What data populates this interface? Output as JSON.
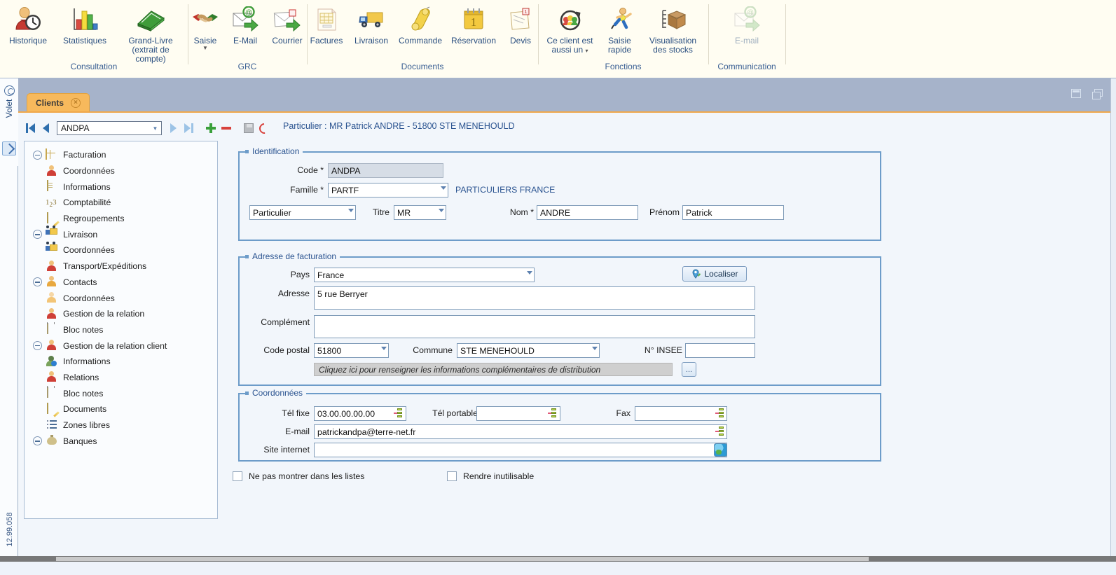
{
  "ribbon": {
    "groups": [
      {
        "title": "Consultation",
        "items": [
          {
            "label": "Historique",
            "icon": "history-person-clock-icon",
            "wide": false,
            "caret": false
          },
          {
            "label": "Statistiques",
            "icon": "bar-chart-icon",
            "wide": false,
            "caret": false
          },
          {
            "label": "Grand-Livre\n(extrait de compte)",
            "icon": "green-book-icon",
            "wide": true,
            "caret": false
          }
        ]
      },
      {
        "title": "GRC",
        "items": [
          {
            "label": "Saisie",
            "icon": "handshake-icon",
            "wide": false,
            "caret": true
          },
          {
            "label": "E-Mail",
            "icon": "email-arrow-icon",
            "wide": false,
            "caret": false
          },
          {
            "label": "Courrier",
            "icon": "letter-arrow-icon",
            "wide": false,
            "caret": false
          }
        ]
      },
      {
        "title": "Documents",
        "items": [
          {
            "label": "Factures",
            "icon": "invoice-icon",
            "wide": false,
            "caret": false
          },
          {
            "label": "Livraison",
            "icon": "truck-icon",
            "wide": false,
            "caret": false
          },
          {
            "label": "Commande",
            "icon": "phone-handset-icon",
            "wide": false,
            "caret": false
          },
          {
            "label": "Réservation",
            "icon": "calendar-icon",
            "wide": false,
            "caret": false
          },
          {
            "label": "Devis",
            "icon": "envelope-stack-icon",
            "wide": false,
            "caret": false
          }
        ]
      },
      {
        "title": "Fonctions",
        "items": [
          {
            "label": "Ce client est\naussi un",
            "icon": "group-refresh-icon",
            "wide": true,
            "caret": true
          },
          {
            "label": "Saisie\nrapide",
            "icon": "running-man-icon",
            "wide": true,
            "caret": false
          },
          {
            "label": "Visualisation\ndes stocks",
            "icon": "box-stock-icon",
            "wide": true,
            "caret": false
          }
        ]
      },
      {
        "title": "Communication",
        "items": [
          {
            "label": "E-mail",
            "icon": "email-arrow-disabled-icon",
            "wide": false,
            "caret": false
          }
        ]
      }
    ]
  },
  "leftrail": {
    "panel_label": "Volet",
    "version": "12.99.058"
  },
  "tabbar": {
    "tabs": [
      {
        "label": "Clients",
        "close": "×"
      }
    ]
  },
  "navbar": {
    "first_label": "first-record",
    "prev_label": "previous-record",
    "next_label": "next-record",
    "last_label": "last-record",
    "code_value": "ANDPA",
    "add_label": "add-record",
    "delete_label": "delete-record",
    "save_label": "save-record",
    "undo_label": "undo-changes",
    "record_title": "Particulier : MR Patrick ANDRE - 51800 STE MENEHOULD"
  },
  "tree": {
    "nodes": [
      {
        "label": "Facturation",
        "level": 0,
        "expander": true,
        "icon": "grid-icon"
      },
      {
        "label": "Coordonnées",
        "level": 1,
        "expander": false,
        "icon": "person-red-icon"
      },
      {
        "label": "Informations",
        "level": 1,
        "expander": false,
        "icon": "document-icon"
      },
      {
        "label": "Comptabilité",
        "level": 1,
        "expander": false,
        "icon": "numbers-123-icon"
      },
      {
        "label": "Regroupements",
        "level": 1,
        "expander": false,
        "icon": "regroup-doc-icon"
      },
      {
        "label": "Livraison",
        "level": 0,
        "expander": true,
        "icon": "truck-icon"
      },
      {
        "label": "Coordonnées",
        "level": 1,
        "expander": false,
        "icon": "truck-icon"
      },
      {
        "label": "Transport/Expéditions",
        "level": 1,
        "expander": false,
        "icon": "transport-icon"
      },
      {
        "label": "Contacts",
        "level": 0,
        "expander": true,
        "icon": "person-icon"
      },
      {
        "label": "Coordonnées",
        "level": 1,
        "expander": false,
        "icon": "person-pale-icon"
      },
      {
        "label": "Gestion de la relation",
        "level": 1,
        "expander": false,
        "icon": "relation-icon"
      },
      {
        "label": "Bloc notes",
        "level": 1,
        "expander": false,
        "icon": "notepad-icon"
      },
      {
        "label": "Gestion de la relation client",
        "level": 0,
        "expander": true,
        "icon": "relation-client-icon"
      },
      {
        "label": "Informations",
        "level": 1,
        "expander": false,
        "icon": "info-person-icon"
      },
      {
        "label": "Relations",
        "level": 1,
        "expander": false,
        "icon": "relation-icon"
      },
      {
        "label": "Bloc notes",
        "level": 0,
        "expander": false,
        "icon": "notepad-icon"
      },
      {
        "label": "Documents",
        "level": 0,
        "expander": false,
        "icon": "documents-pencil-icon"
      },
      {
        "label": "Zones libres",
        "level": 0,
        "expander": false,
        "icon": "list-icon"
      },
      {
        "label": "Banques",
        "level": 0,
        "expander": true,
        "icon": "money-bag-icon"
      }
    ]
  },
  "form": {
    "identification": {
      "legend": "Identification",
      "code_label": "Code *",
      "code_value": "ANDPA",
      "famille_label": "Famille *",
      "famille_value": "PARTF",
      "famille_desc": "PARTICULIERS FRANCE",
      "type_value": "Particulier",
      "titre_label": "Titre",
      "titre_value": "MR",
      "nom_label": "Nom *",
      "nom_value": "ANDRE",
      "prenom_label": "Prénom",
      "prenom_value": "Patrick"
    },
    "adresse": {
      "legend": "Adresse de facturation",
      "pays_label": "Pays",
      "pays_value": "France",
      "localiser_label": "Localiser",
      "adresse_label": "Adresse",
      "adresse_value": "5 rue Berryer",
      "complement_label": "Complément",
      "complement_value": "",
      "cp_label": "Code postal",
      "cp_value": "51800",
      "commune_label": "Commune",
      "commune_value": "STE MENEHOULD",
      "insee_label": "N° INSEE",
      "insee_value": "",
      "hint": "Cliquez ici pour renseigner les informations complémentaires de distribution",
      "dots_label": "..."
    },
    "coordonnees": {
      "legend": "Coordonnées",
      "telfixe_label": "Tél fixe",
      "telfixe_value": "03.00.00.00.00",
      "telport_label": "Tél portable",
      "telport_value": "",
      "fax_label": "Fax",
      "fax_value": "",
      "email_label": "E-mail",
      "email_value": "patrickandpa@terre-net.fr",
      "site_label": "Site internet",
      "site_value": ""
    },
    "checkboxes": [
      {
        "label": "Ne pas montrer dans les listes",
        "checked": false
      },
      {
        "label": "Rendre inutilisable",
        "checked": false
      }
    ]
  },
  "colors": {
    "ribbon_bg": "#FFFDF2",
    "band_blue": "#A6B3CA",
    "tab_orange": "#F7B95C",
    "group_border": "#6D9CC9",
    "accent_text": "#2A5390",
    "form_bg": "#F2F6FB"
  }
}
